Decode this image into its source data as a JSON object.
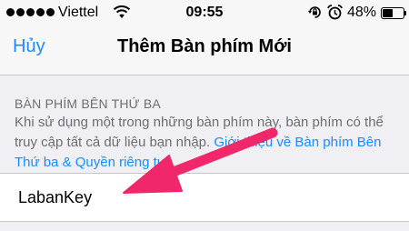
{
  "status_bar": {
    "carrier": "Viettel",
    "time": "09:55",
    "battery_percent": "48%",
    "battery_level": 0.48,
    "signal_dots": 5
  },
  "nav": {
    "cancel_label": "Hủy",
    "title": "Thêm Bàn phím Mới"
  },
  "section": {
    "header": "BÀN PHÍM BÊN THỨ BA",
    "footer_text": "Khi sử dụng một trong những bàn phím này, bàn phím có thể truy cập tất cả dữ liệu bạn nhập. ",
    "footer_link": "Giới thiệu về Bàn phím Bên Thứ ba & Quyền riêng tư"
  },
  "keyboards": [
    {
      "label": "LabanKey"
    }
  ],
  "colors": {
    "tint": "#1a8cff",
    "annotation_arrow": "#f0276a"
  }
}
